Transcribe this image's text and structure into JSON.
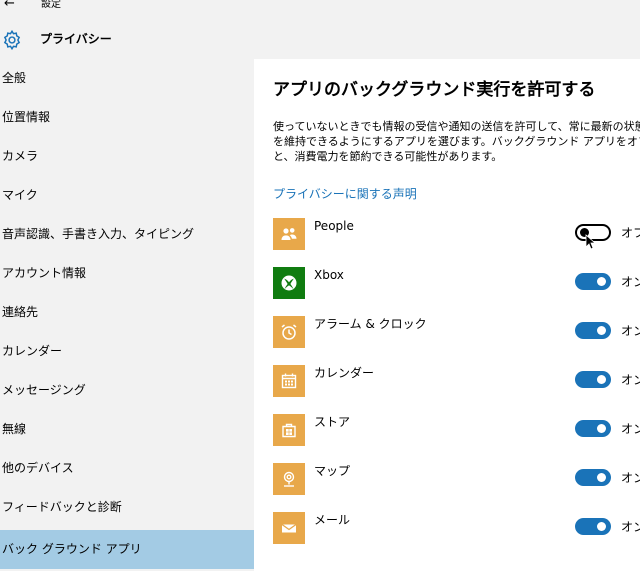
{
  "window": {
    "back_glyph": "←",
    "title": "設定"
  },
  "header": {
    "icon": "gear-icon",
    "title": "プライバシー"
  },
  "sidebar": {
    "items": [
      {
        "label": "全般"
      },
      {
        "label": "位置情報"
      },
      {
        "label": "カメラ"
      },
      {
        "label": "マイク"
      },
      {
        "label": "音声認識、手書き入力、タイピング"
      },
      {
        "label": "アカウント情報"
      },
      {
        "label": "連絡先"
      },
      {
        "label": "カレンダー"
      },
      {
        "label": "メッセージング"
      },
      {
        "label": "無線"
      },
      {
        "label": "他のデバイス"
      },
      {
        "label": "フィードバックと診断"
      },
      {
        "label": "バック グラウンド アプリ"
      }
    ],
    "selected": "バック グラウンド アプリ"
  },
  "main": {
    "title": "アプリのバックグラウンド実行を許可する",
    "description": [
      "使っていないときでも情報の受信や通知の送信を許可して、常に最新の状態",
      "を維持できるようにするアプリを選びます。バックグラウンド アプリをオフにする",
      "と、消費電力を節約できる可能性があります。"
    ],
    "privacy_link": "プライバシーに関する声明",
    "apps": [
      {
        "name": "People",
        "icon": "people-icon",
        "color": "#e8a84a",
        "state": "off",
        "state_label": "オフ"
      },
      {
        "name": "Xbox",
        "icon": "xbox-icon",
        "color": "#107c10",
        "state": "on",
        "state_label": "オン"
      },
      {
        "name": "アラーム & クロック",
        "icon": "alarm-clock-icon",
        "color": "#e8a84a",
        "state": "on",
        "state_label": "オン"
      },
      {
        "name": "カレンダー",
        "icon": "calendar-icon",
        "color": "#e8a84a",
        "state": "on",
        "state_label": "オン"
      },
      {
        "name": "ストア",
        "icon": "store-icon",
        "color": "#e8a84a",
        "state": "on",
        "state_label": "オン"
      },
      {
        "name": "マップ",
        "icon": "maps-icon",
        "color": "#e8a84a",
        "state": "on",
        "state_label": "オン"
      },
      {
        "name": "メール",
        "icon": "mail-icon",
        "color": "#e8a84a",
        "state": "on",
        "state_label": "オン"
      }
    ]
  },
  "colors": {
    "accent": "#1a73b8",
    "selected_nav": "#a3cbe4",
    "sidebar_bg": "#f2f2f2"
  }
}
